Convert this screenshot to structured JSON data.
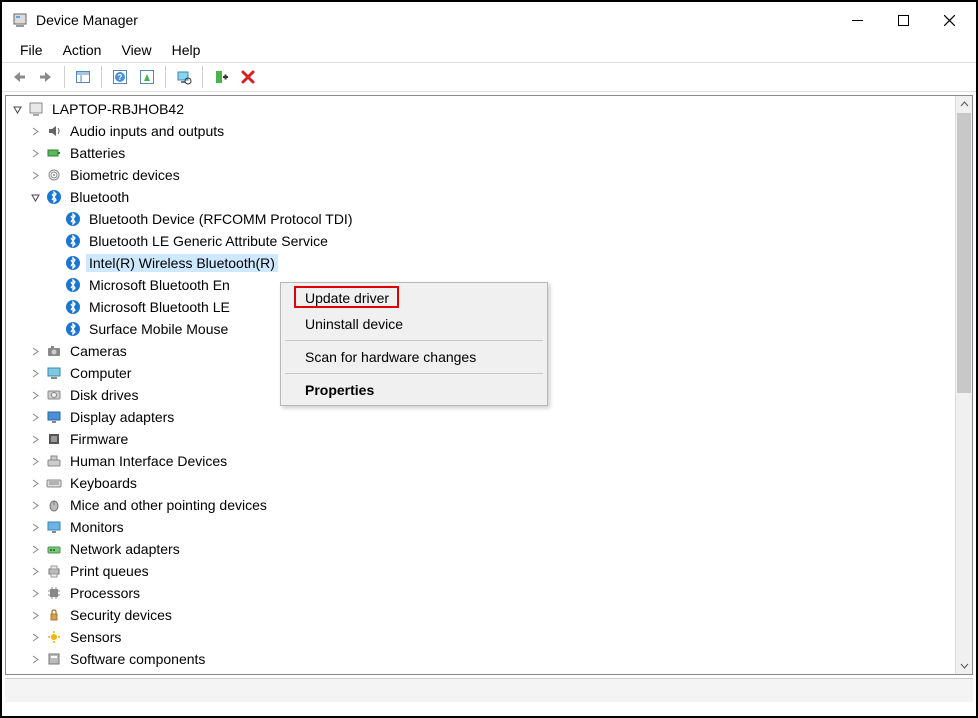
{
  "window": {
    "title": "Device Manager"
  },
  "menus": {
    "file": "File",
    "action": "Action",
    "view": "View",
    "help": "Help"
  },
  "tree": {
    "root": "LAPTOP-RBJHOB42",
    "cat_audio": "Audio inputs and outputs",
    "cat_batteries": "Batteries",
    "cat_biometric": "Biometric devices",
    "cat_bluetooth": "Bluetooth",
    "bt_rfcomm": "Bluetooth Device (RFCOMM Protocol TDI)",
    "bt_le_gatt": "Bluetooth LE Generic Attribute Service",
    "bt_intel": "Intel(R) Wireless Bluetooth(R)",
    "bt_ms_enum": "Microsoft Bluetooth En",
    "bt_ms_le": "Microsoft Bluetooth LE ",
    "bt_mouse": "Surface Mobile Mouse",
    "cat_cameras": "Cameras",
    "cat_computer": "Computer",
    "cat_disk": "Disk drives",
    "cat_display": "Display adapters",
    "cat_firmware": "Firmware",
    "cat_hid": "Human Interface Devices",
    "cat_keyboards": "Keyboards",
    "cat_mice": "Mice and other pointing devices",
    "cat_monitors": "Monitors",
    "cat_network": "Network adapters",
    "cat_print": "Print queues",
    "cat_processors": "Processors",
    "cat_security": "Security devices",
    "cat_sensors": "Sensors",
    "cat_software": "Software components"
  },
  "context_menu": {
    "update_driver": "Update driver",
    "uninstall_device": "Uninstall device",
    "scan_hw": "Scan for hardware changes",
    "properties": "Properties"
  }
}
